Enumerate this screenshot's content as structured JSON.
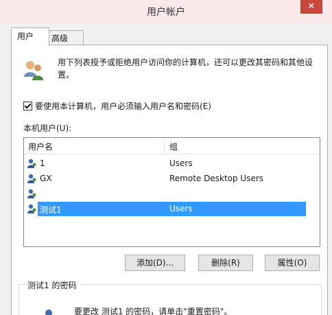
{
  "window": {
    "title": "用户帐户",
    "close_glyph": "✕"
  },
  "tabs": [
    {
      "label": "用户",
      "active": true
    },
    {
      "label": "高级",
      "active": false
    }
  ],
  "users_panel": {
    "description": "用下列表授予或拒绝用户访问你的计算机，还可以更改其密码和其他设置。",
    "require_password_checkbox": {
      "label": "要使用本计算机，用户必须输入用户名和密码(E)",
      "checked": true
    },
    "local_users_label": "本机用户(U):",
    "list": {
      "columns": [
        "用户名",
        "组"
      ],
      "rows": [
        {
          "user": "1",
          "group": "Users",
          "selected": false
        },
        {
          "user": "GX",
          "group": "Remote Desktop Users",
          "selected": false
        },
        {
          "user": "",
          "group": "",
          "selected": false
        },
        {
          "user": "测试1",
          "group": "Users",
          "selected": true
        }
      ]
    },
    "buttons": {
      "add": "添加(D)...",
      "remove": "删除(R)",
      "properties": "属性(O)"
    },
    "password_group": {
      "title": "测试1 的密码",
      "text": "要更改 测试1 的密码，请单击\"重置密码\"。"
    }
  },
  "colors": {
    "selection": "#3399ff",
    "titlebar": "#fbe8ea",
    "close": "#c7473a"
  },
  "icons": {
    "users": "users-icon",
    "user": "user-icon",
    "password": "password-icon"
  }
}
